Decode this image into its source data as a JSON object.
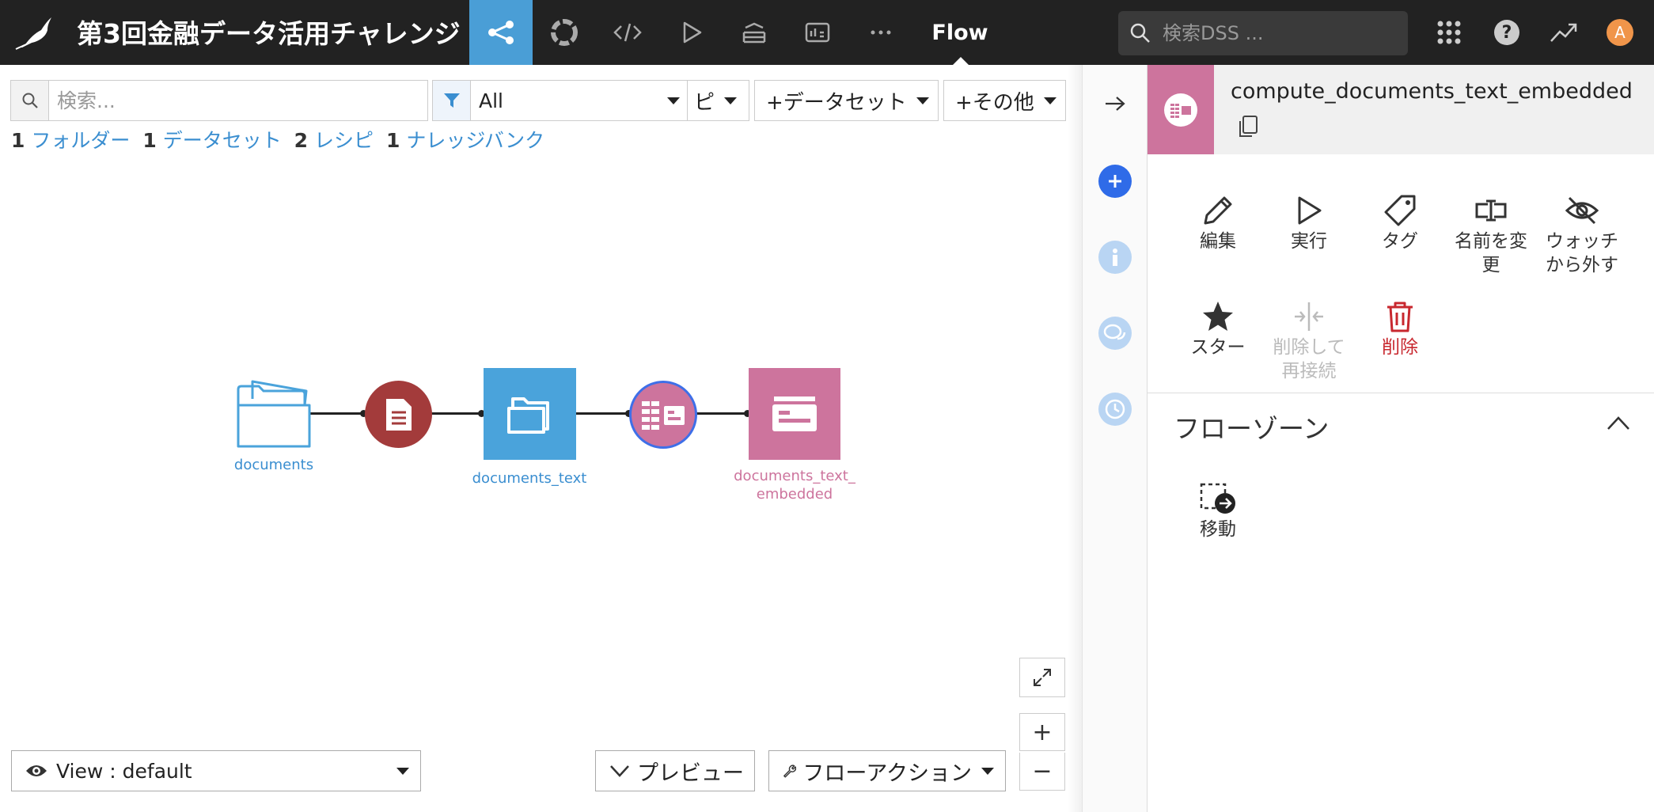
{
  "header": {
    "project_title": "第3回金融データ活用チャレンジ",
    "flow_tab": "Flow",
    "search_placeholder": "検索DSS ...",
    "avatar_letter": "A",
    "nav_icons": [
      "flow-icon",
      "lab-icon",
      "code-icon",
      "run-icon",
      "stack-icon",
      "dashboard-icon",
      "more-icon"
    ]
  },
  "toolbar": {
    "search_placeholder": "検索...",
    "filter_value": "All",
    "recipe_label": "ピ",
    "dataset_label": "+データセット",
    "other_label": "+その他"
  },
  "counts": [
    {
      "count": "1",
      "label": "フォルダー"
    },
    {
      "count": "1",
      "label": "データセット"
    },
    {
      "count": "2",
      "label": "レシピ"
    },
    {
      "count": "1",
      "label": "ナレッジバンク"
    }
  ],
  "flow": {
    "nodes": [
      {
        "label": "documents",
        "type": "folder"
      },
      {
        "label": "",
        "type": "recipe-extract"
      },
      {
        "label": "documents_text",
        "type": "managed-folder"
      },
      {
        "label": "",
        "type": "recipe-embed"
      },
      {
        "label_line1": "documents_text_",
        "label_line2": "embedded",
        "type": "knowledge-bank"
      }
    ]
  },
  "canvas_controls": {
    "view_label": "View : default",
    "preview_label": "プレビュー",
    "flow_actions_label": "フローアクション",
    "zoom_in": "+",
    "zoom_out": "−"
  },
  "panel": {
    "title": "compute_documents_text_embedded",
    "actions": {
      "edit": "編集",
      "run": "実行",
      "tag": "タグ",
      "rename_line1": "名前を変",
      "rename_line2": "更",
      "unwatch_line1": "ウォッチ",
      "unwatch_line2": "から外す",
      "star": "スター",
      "delete_reconnect_line1": "削除して",
      "delete_reconnect_line2": "再接続",
      "delete": "削除"
    },
    "zone_title": "フローゾーン",
    "move_label": "移動"
  },
  "colors": {
    "topbar": "#222222",
    "active_tab": "#4a9ed6",
    "folder_blue": "#4aa3db",
    "recipe_red": "#a33b3b",
    "knowledge_pink": "#cd749d",
    "link_blue": "#3a8ed0",
    "danger_red": "#c8282f"
  }
}
